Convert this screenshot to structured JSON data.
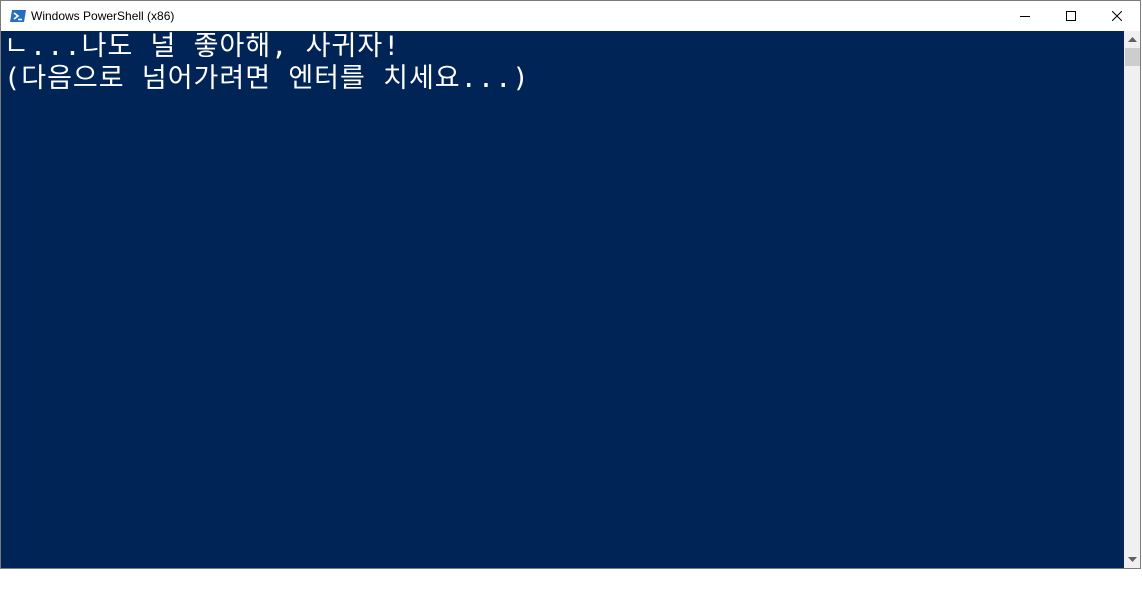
{
  "window": {
    "title": "Windows PowerShell (x86)",
    "icon": "powershell-icon",
    "controls": [
      "minimize-icon",
      "maximize-icon",
      "close-icon"
    ]
  },
  "console": {
    "lines": [
      "ㄴ...나도 널 좋아해, 사귀자!",
      "(다음으로 넘어가려면 엔터를 치세요...)"
    ]
  },
  "colors": {
    "console_background": "#012456",
    "console_text": "#ffffff"
  }
}
